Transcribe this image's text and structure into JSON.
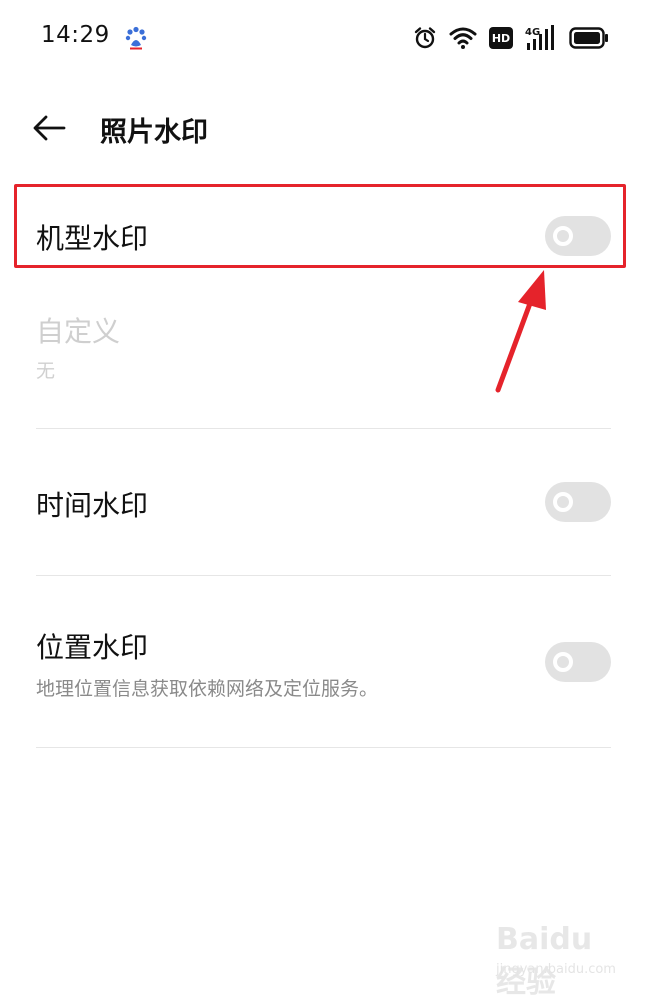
{
  "status_bar": {
    "time": "14:29",
    "network_label": "4G",
    "hd_label": "HD",
    "icons": [
      "baidu-paw-icon",
      "alarm-icon",
      "wifi-icon",
      "hd-icon",
      "signal-icon",
      "battery-icon"
    ]
  },
  "header": {
    "title": "照片水印",
    "back_icon": "back-arrow-icon"
  },
  "settings": {
    "model_watermark": {
      "label": "机型水印",
      "enabled": false
    },
    "custom": {
      "label": "自定义",
      "value": "无",
      "disabled": true
    },
    "time_watermark": {
      "label": "时间水印",
      "enabled": false
    },
    "location_watermark": {
      "label": "位置水印",
      "description": "地理位置信息获取依赖网络及定位服务。",
      "enabled": false
    }
  },
  "annotation": {
    "highlight_color": "#e5232b"
  },
  "watermark": {
    "logo_text": "Baidu经验",
    "url": "jingyan.baidu.com"
  }
}
